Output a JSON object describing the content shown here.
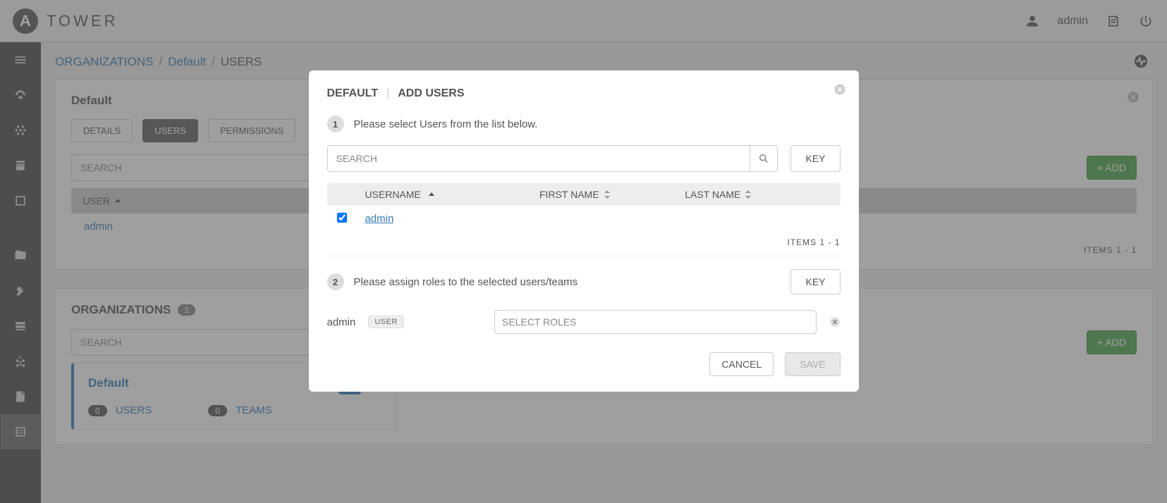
{
  "brand": "TOWER",
  "topbar": {
    "user": "admin"
  },
  "breadcrumb": {
    "org_link": "ORGANIZATIONS",
    "org_name": "Default",
    "section": "USERS"
  },
  "users_panel": {
    "title": "Default",
    "tabs": {
      "details": "DETAILS",
      "users": "USERS",
      "permissions": "PERMISSIONS"
    },
    "search_placeholder": "SEARCH",
    "add_button": "+ ADD",
    "list_header": "USER",
    "rows": [
      "admin"
    ],
    "items_label": "ITEMS  1 - 1"
  },
  "orgs_panel": {
    "title": "ORGANIZATIONS",
    "count": "1",
    "search_placeholder": "SEARCH",
    "add_button": "+ ADD",
    "card": {
      "name": "Default",
      "users_count": "0",
      "users_label": "USERS",
      "teams_count": "0",
      "teams_label": "TEAMS"
    }
  },
  "modal": {
    "title_left": "DEFAULT",
    "title_right": "ADD USERS",
    "step1_num": "1",
    "step1_text": "Please select Users from the list below.",
    "search_placeholder": "SEARCH",
    "key_button": "KEY",
    "columns": {
      "username": "USERNAME",
      "first": "FIRST NAME",
      "last": "LAST NAME"
    },
    "rows": [
      {
        "username": "admin",
        "checked": true
      }
    ],
    "items_label": "ITEMS  1 - 1",
    "step2_num": "2",
    "step2_text": "Please assign roles to the selected users/teams",
    "assign": {
      "name": "admin",
      "badge": "USER",
      "select_placeholder": "SELECT ROLES"
    },
    "cancel": "CANCEL",
    "save": "SAVE"
  }
}
